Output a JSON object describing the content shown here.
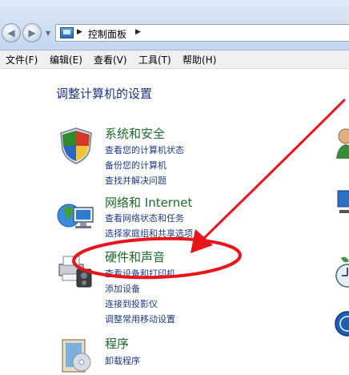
{
  "breadcrumb": {
    "location": "控制面板"
  },
  "menu": [
    {
      "label": "文件(F)"
    },
    {
      "label": "编辑(E)"
    },
    {
      "label": "查看(V)"
    },
    {
      "label": "工具(T)"
    },
    {
      "label": "帮助(H)"
    }
  ],
  "page": {
    "title": "调整计算机的设置"
  },
  "categories": [
    {
      "title": "系统和安全",
      "icon": "shield-icon",
      "links": [
        "查看您的计算机状态",
        "备份您的计算机",
        "查找并解决问题"
      ]
    },
    {
      "title": "网络和 Internet",
      "icon": "network-globe-icon",
      "links": [
        "查看网络状态和任务",
        "选择家庭组和共享选项"
      ]
    },
    {
      "title": "硬件和声音",
      "icon": "printer-icon",
      "links": [
        "查看设备和打印机",
        "添加设备",
        "连接到投影仪",
        "调整常用移动设置"
      ]
    },
    {
      "title": "程序",
      "icon": "programs-box-icon",
      "links": [
        "卸载程序"
      ]
    }
  ],
  "annotation": {
    "color": "#e8151b",
    "highlighted_category": "硬件和声音"
  }
}
